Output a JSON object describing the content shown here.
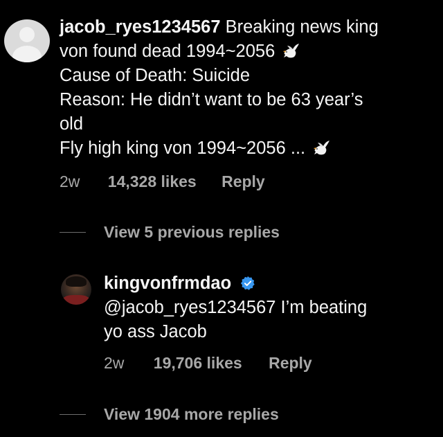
{
  "comment1": {
    "username": "jacob_ryes1234567",
    "line1_text": "Breaking news king",
    "line2": "von found dead 1994~2056",
    "line3": "Cause of Death: Suicide",
    "line4": "Reason: He didn’t want to be 63 year’s",
    "line5": "old",
    "line6": "Fly high king von 1994~2056 ...",
    "time": "2w",
    "likes": "14,328 likes",
    "reply": "Reply"
  },
  "view_previous": "View 5 previous replies",
  "comment2": {
    "username": "kingvonfrmdao",
    "line1": "@jacob_ryes1234567 I’m beating",
    "line2": "yo ass Jacob",
    "time": "2w",
    "likes": "19,706 likes",
    "reply": "Reply"
  },
  "view_more": "View 1904 more replies",
  "colors": {
    "background": "#000000",
    "text": "#f5f5f5",
    "secondary": "#a8a8a8",
    "verified": "#3897f0"
  },
  "icons": {
    "dove": "dove-emoji",
    "verified": "verified-badge-icon"
  }
}
